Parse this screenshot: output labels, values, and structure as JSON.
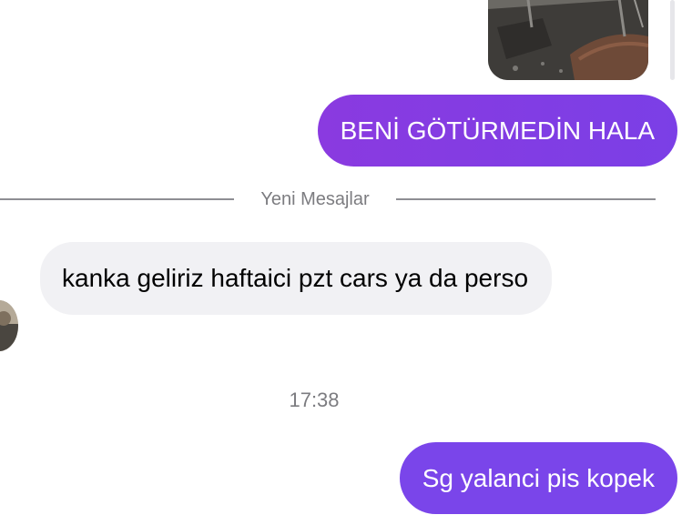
{
  "thread": {
    "divider_label": "Yeni Mesajlar",
    "timestamp": "17:38"
  },
  "messages": [
    {
      "direction": "outgoing",
      "kind": "image",
      "description_icon": "photo-thumbnail"
    },
    {
      "direction": "outgoing",
      "kind": "text",
      "text": "BENİ GÖTÜRMEDİN HALA"
    },
    {
      "direction": "incoming",
      "kind": "text",
      "text": "kanka geliriz haftaici pzt cars ya da perso"
    },
    {
      "direction": "outgoing",
      "kind": "text",
      "text": "Sg yalanci pis kopek"
    }
  ],
  "colors": {
    "outgoing_bubble": "#8a3ae0",
    "outgoing_bubble_2": "#7a45ea",
    "incoming_bubble": "#f1f1f4",
    "meta_text": "#7c7c80"
  }
}
